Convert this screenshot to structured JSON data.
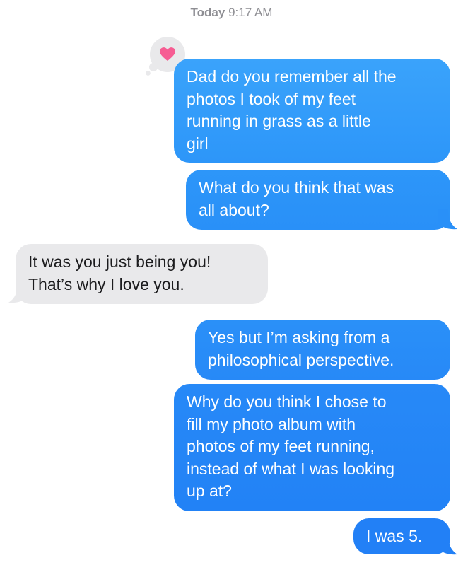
{
  "conversation": {
    "timestamp": {
      "day": "Today",
      "time": "9:17 AM"
    },
    "messages": [
      {
        "sender": "me",
        "text": "Dad do you remember all the\nphotos I took of my feet\nrunning in grass as a little\ngirl",
        "reaction": "heart"
      },
      {
        "sender": "me",
        "text": "What do you think that was\nall about?"
      },
      {
        "sender": "dad",
        "text": "It was you just being you!\nThat’s why I love you."
      },
      {
        "sender": "me",
        "text": "Yes but I’m asking from a\nphilosophical perspective."
      },
      {
        "sender": "me",
        "text": "Why do you think I chose to\nfill my photo album with\nphotos of my feet running,\ninstead of what I was looking\nup at?"
      },
      {
        "sender": "me",
        "text": "I was 5."
      }
    ]
  },
  "colors": {
    "sent_bubble": "#2d96f9",
    "received_bubble": "#e9e9eb",
    "reaction_heart": "#f65d93",
    "timestamp_text": "#8e8e93"
  },
  "icons": {
    "reaction": "heart-icon"
  }
}
